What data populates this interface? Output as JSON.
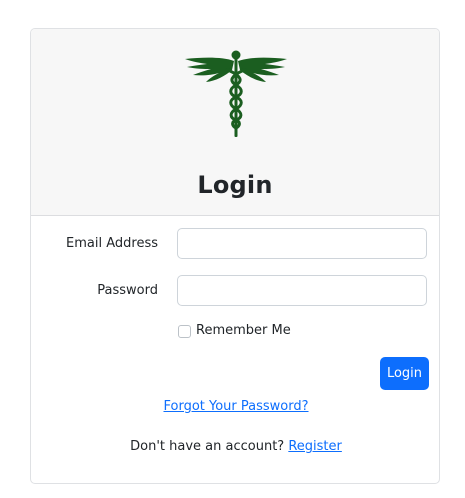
{
  "colors": {
    "logo_green": "#1b5e20",
    "primary": "#0d6efd",
    "header_bg": "#f7f7f7",
    "border": "#dfe1e4"
  },
  "header": {
    "logo_icon": "caduceus-icon",
    "title": "Login"
  },
  "form": {
    "email": {
      "label": "Email Address",
      "value": "",
      "placeholder": ""
    },
    "password": {
      "label": "Password",
      "value": "",
      "placeholder": ""
    },
    "remember": {
      "label": "Remember Me",
      "checked": false
    },
    "submit_label": "Login"
  },
  "links": {
    "forgot": "Forgot Your Password?",
    "no_account_text": "Don't have an account? ",
    "register": "Register"
  }
}
